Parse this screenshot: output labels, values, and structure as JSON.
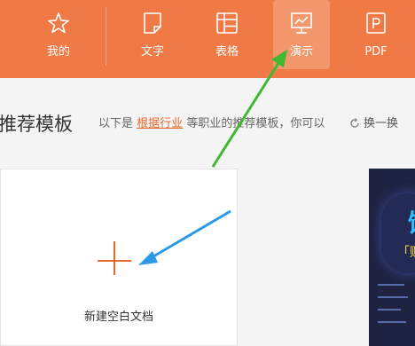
{
  "toolbar": {
    "tabs": [
      {
        "label": "我的",
        "icon": "star-icon"
      },
      {
        "label": "文字",
        "icon": "document-icon"
      },
      {
        "label": "表格",
        "icon": "table-icon"
      },
      {
        "label": "演示",
        "icon": "presentation-icon"
      },
      {
        "label": "PDF",
        "icon": "pdf-icon"
      }
    ],
    "active_tab": "演示"
  },
  "section": {
    "title": "推荐模板",
    "subtitle_prefix": "以下是",
    "subtitle_link": "根据行业",
    "subtitle_suffix": "等职业的推荐模板，你可以",
    "refresh_label": "换一换"
  },
  "new_card": {
    "label": "新建空白文档"
  },
  "template_card": {
    "title_char": "饭",
    "subtitle": "「财"
  },
  "colors": {
    "brand": "#f07a45",
    "link": "#e8692d",
    "green_arrow": "#3fb832",
    "blue_arrow": "#2b9ae8"
  }
}
